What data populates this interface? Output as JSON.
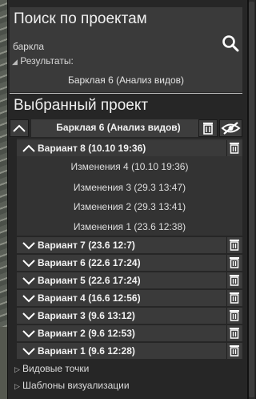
{
  "search": {
    "title": "Поиск по проектам",
    "query": "баркла",
    "results_header": "Результаты:",
    "results": [
      "Барклая 6 (Анализ видов)"
    ]
  },
  "selected": {
    "title": "Выбранный проект",
    "project_name": "Барклая 6 (Анализ видов)"
  },
  "variants": [
    {
      "label": "Вариант 8 (10.10 19:36)",
      "expanded": true,
      "changes": [
        "Изменения 4 (10.10 19:36)",
        "Изменения 3 (29.3 13:47)",
        "Изменения 2 (29.3 13:41)",
        "Изменения 1 (23.6 12:38)"
      ]
    },
    {
      "label": "Вариант 7 (23.6 12:7)",
      "expanded": false
    },
    {
      "label": "Вариант 6 (22.6 17:24)",
      "expanded": false
    },
    {
      "label": "Вариант 5 (22.6 17:24)",
      "expanded": false
    },
    {
      "label": "Вариант 4 (16.6 12:56)",
      "expanded": false
    },
    {
      "label": "Вариант 3 (9.6 13:12)",
      "expanded": false
    },
    {
      "label": "Вариант 2 (9.6 12:53)",
      "expanded": false
    },
    {
      "label": "Вариант 1 (9.6 12:28)",
      "expanded": false
    }
  ],
  "tree": {
    "viewpoints": "Видовые точки",
    "templates": "Шаблоны визуализации"
  }
}
